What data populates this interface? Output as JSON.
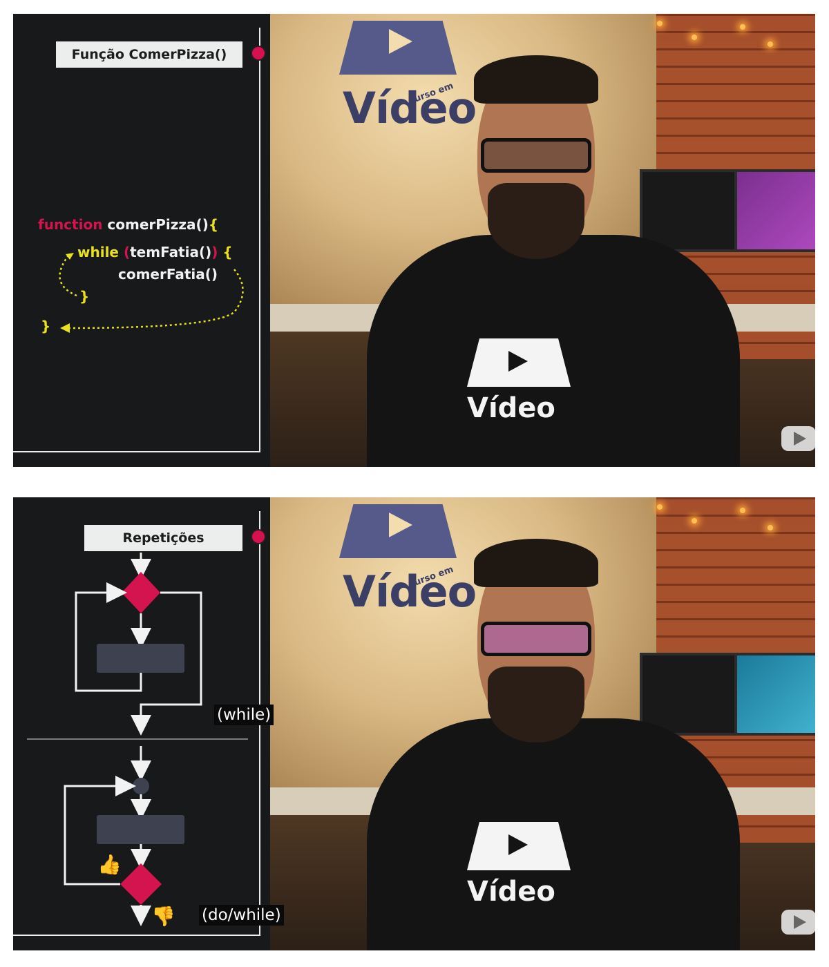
{
  "frame_top": {
    "title": "Função ComerPizza()",
    "code": {
      "line1_keyword": "function",
      "line1_name": " comerPizza()",
      "line1_brace": "{",
      "line2_keyword": "while",
      "line2_paren_open": " (",
      "line2_call": "temFatia()",
      "line2_paren_close": ")",
      "line2_brace": " {",
      "line3": "comerFatia()",
      "line4_brace": "}",
      "line5_brace": "}"
    },
    "logo_text": "Vídeo",
    "logo_small": "curso em",
    "shirt_text": "Vídeo"
  },
  "frame_bottom": {
    "title": "Repetições",
    "caption_while": "(while)",
    "caption_dowhile": "(do/while)",
    "thumb_up": "👍",
    "thumb_down": "👎",
    "logo_text": "Vídeo",
    "logo_small": "curso em",
    "shirt_text": "Vídeo"
  },
  "colors": {
    "keyword": "#d4144e",
    "text": "#f2f2f2",
    "brace": "#e9e11b",
    "diamond": "#d4144e",
    "panel_bg": "#17191b",
    "title_bg": "#eceeed"
  },
  "icons": [
    "red-dot",
    "play-logo",
    "youtube-watermark",
    "thumbs-up",
    "thumbs-down"
  ]
}
